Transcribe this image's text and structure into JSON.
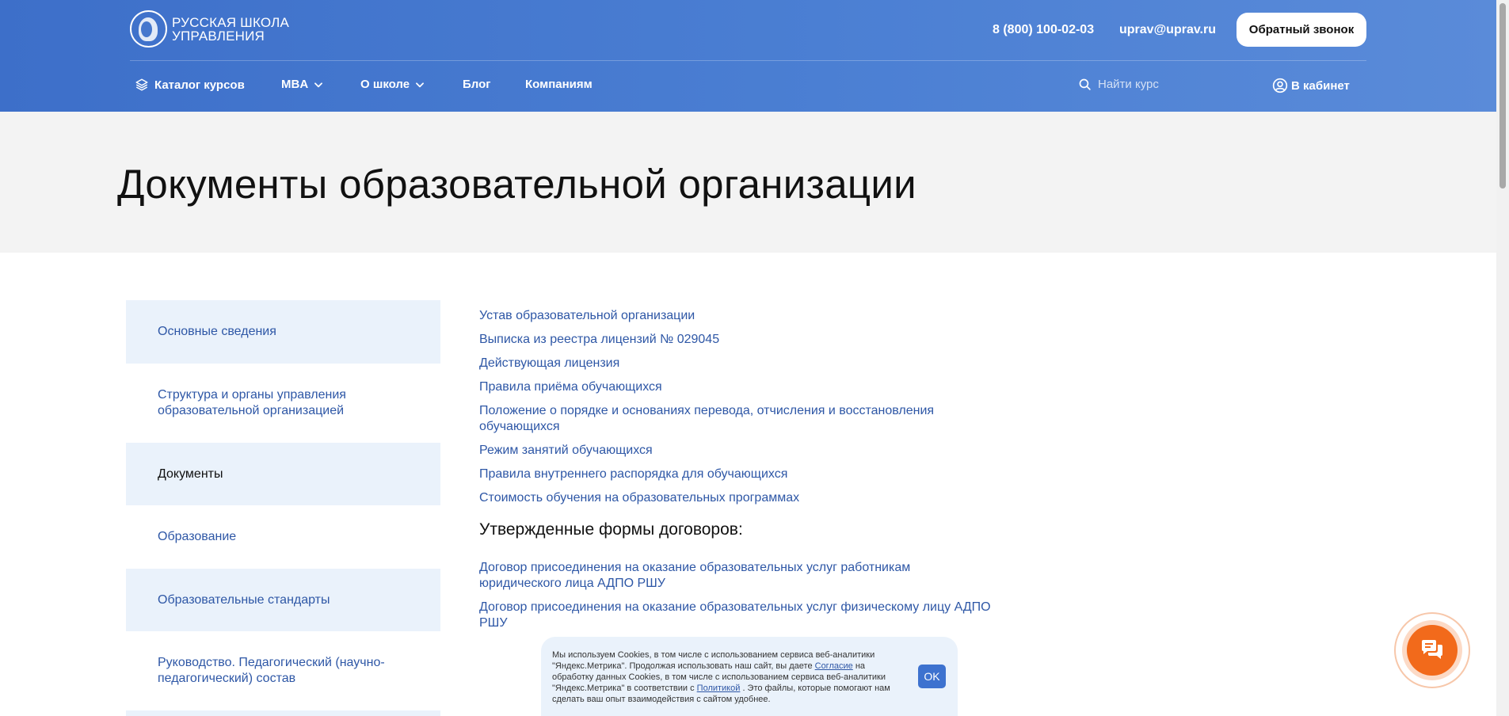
{
  "header": {
    "logo_line1": "РУССКАЯ ШКОЛА",
    "logo_line2": "УПРАВЛЕНИЯ",
    "phone": "8 (800) 100-02-03",
    "email": "uprav@uprav.ru",
    "callback_label": "Обратный звонок",
    "nav": {
      "catalog": "Каталог курсов",
      "mba": "MBA",
      "about": "О школе",
      "blog": "Блог",
      "companies": "Компаниям"
    },
    "search_placeholder": "Найти курс",
    "cabinet_label": "В кабинет"
  },
  "page": {
    "title": "Документы образовательной организации"
  },
  "sidebar": {
    "items": [
      {
        "label": "Основные сведения"
      },
      {
        "label": "Структура и органы управления образовательной организацией"
      },
      {
        "label": "Документы"
      },
      {
        "label": "Образование"
      },
      {
        "label": "Образовательные стандарты"
      },
      {
        "label": "Руководство. Педагогический (научно-педагогический) состав"
      }
    ]
  },
  "content": {
    "documents": [
      "Устав образовательной организации",
      "Выписка из реестра лицензий № 029045",
      "Действующая лицензия",
      "Правила приёма обучающихся",
      "Положение о порядке и основаниях перевода, отчисления и восстановления обучающихся",
      "Режим занятий обучающихся",
      "Правила внутреннего распорядка для обучающихся",
      "Стоимость обучения на образовательных программах"
    ],
    "contracts_heading": "Утвержденные формы договоров:",
    "contracts": [
      "Договор присоединения на оказание образовательных услуг работникам юридического лица АДПО РШУ",
      "Договор присоединения на оказание образовательных услуг физическому лицу АДПО РШУ"
    ]
  },
  "cookie": {
    "text_1": "Мы используем Cookies, в том числе с использованием сервиса веб-аналитики \"Яндекс.Метрика\". Продолжая использовать наш сайт, вы даете ",
    "link_1": "Согласие",
    "text_2": " на обработку данных Cookies, в том числе с использованием сервиса веб-аналитики \"Яндекс.Метрика\" в соответствии с ",
    "link_2": "Политикой",
    "text_3": " . Это файлы, которые помогают нам сделать ваш опыт взаимодействия с сайтом удобнее.",
    "ok_label": "OK"
  },
  "colors": {
    "header_blue": "#4577cd",
    "link_blue": "#2e57a6",
    "sidebar_shade": "#eaf2fb",
    "chat_orange": "#f26a1b"
  },
  "icons": {
    "catalog": "layers-icon",
    "dropdown": "chevron-down-icon",
    "search": "search-icon",
    "cabinet": "user-circle-icon",
    "chat": "chat-bubbles-icon"
  }
}
